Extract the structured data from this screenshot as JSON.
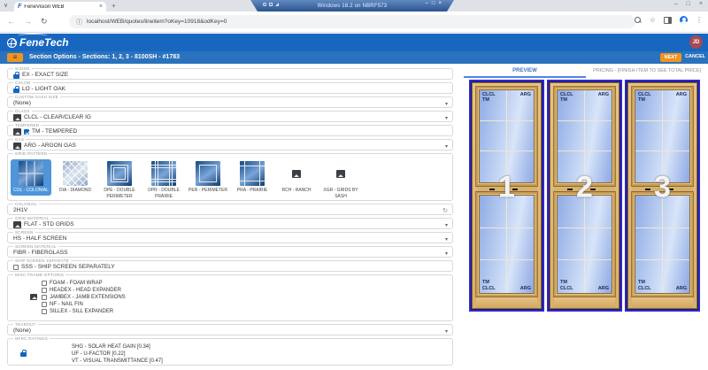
{
  "vm": {
    "title": "Windows 18.2 on NBRF573",
    "minimize": "–",
    "restore": "□",
    "close": "×"
  },
  "browser": {
    "tab_title": "FeneVision WEB",
    "favicon": "F",
    "tab_close": "×",
    "new_tab": "+",
    "tab_chevron": "∨",
    "back": "←",
    "forward": "→",
    "reload": "↻",
    "url_info": "ⓘ",
    "url": "localhost/WEB/quotes/lineitem?oKey=10918&odKey=0",
    "star": "☆",
    "kebab": "⋮",
    "win_minimize": "–",
    "win_maximize": "□",
    "win_close": "×"
  },
  "header": {
    "brand": "FeneTech",
    "avatar": "JD"
  },
  "sectionbar": {
    "hamburger": "≡",
    "title": "Section Options - Sections: 1, 2, 3 - 8100SH - #1783",
    "next": "NEXT",
    "cancel": "CANCEL"
  },
  "ui": {
    "caret": "▾",
    "refresh": "↻"
  },
  "form": {
    "sizing": {
      "label": "SIZING",
      "value": "EX - EXACT SIZE"
    },
    "color": {
      "label": "COLOR",
      "value": "LO - LIGHT OAK"
    },
    "custom_sash_size": {
      "label": "CUSTOM SASH SIZE",
      "value": "(None)"
    },
    "glass": {
      "label": "GLASS",
      "value": "CLCL - CLEAR/CLEAR IG"
    },
    "tempered": {
      "label": "TEMPERED",
      "value": "TM - TEMPERED"
    },
    "gas": {
      "label": "GAS",
      "value": "ARG - ARGON GAS"
    },
    "grid_pattern": {
      "label": "GRID PATTERN",
      "tiles": [
        {
          "caption": "COL - COLONIAL"
        },
        {
          "caption": "DIA - DIAMOND"
        },
        {
          "caption": "DPE - DOUBLE PERIMETER"
        },
        {
          "caption": "DPR - DOUBLE PRAIRIE"
        },
        {
          "caption": "PER - PERIMETER"
        },
        {
          "caption": "PRA - PRAIRIE"
        },
        {
          "caption": "RCH - RANCH"
        },
        {
          "caption": "XGR - GRIDS BY SASH"
        }
      ]
    },
    "colonial": {
      "label": "COLONIAL",
      "value": "2H1V"
    },
    "grid_material": {
      "label": "GRID MATERIAL",
      "value": "FLAT - STD GRIDS"
    },
    "screen": {
      "label": "SCREEN",
      "value": "HS - HALF SCREEN"
    },
    "screen_material": {
      "label": "SCREEN MATERIAL",
      "value": "FIBR - FIBERGLASS"
    },
    "ship_screen_separate": {
      "label": "SHIP SCREEN SEPARATE",
      "option": "SSS - SHIP SCREEN SEPARATELY"
    },
    "misc_frame_options": {
      "label": "MISC FRAME OPTIONS",
      "options": [
        "FOAM - FOAM WRAP",
        "HEADEX - HEAD EXPANDER",
        "JAMBEX - JAMB EXTENSIONS",
        "NF - NAIL FIN",
        "SILLEX - SILL EXPANDER"
      ]
    },
    "tearout": {
      "label": "TEAROUT",
      "value": "(None)"
    },
    "nfrc": {
      "label": "NFRC RATINGS",
      "lines": [
        "SHG - SOLAR HEAT GAIN [0.34]",
        "UF - U-FACTOR [0.22]",
        "VT - VISUAL TRANSMITTANCE [0.47]"
      ]
    }
  },
  "preview": {
    "tab_preview": "PREVIEW",
    "tab_pricing": "PRICING - [FINISH ITEM TO SEE TOTAL PRICE]",
    "windows": [
      {
        "number": "1",
        "top_l1": "CLCL",
        "top_l2": "TM",
        "top_r": "ARG",
        "bot_l1": "TM",
        "bot_l2": "CLCL",
        "bot_r": "ARG"
      },
      {
        "number": "2",
        "top_l1": "CLCL",
        "top_l2": "TM",
        "top_r": "ARG",
        "bot_l1": "TM",
        "bot_l2": "CLCL",
        "bot_r": "ARG"
      },
      {
        "number": "3",
        "top_l1": "CLCL",
        "top_l2": "TM",
        "top_r": "ARG",
        "bot_l1": "TM",
        "bot_l2": "CLCL",
        "bot_r": "ARG"
      }
    ]
  },
  "colors": {
    "header_blue": "#1766c0",
    "section_blue": "#2a72bd",
    "accent_orange": "#ef9322",
    "selected_tile_blue": "#4e95d9",
    "avatar_red": "#a84a52",
    "preview_border_blue": "#2f28cb",
    "oak_frame": "#e6c285"
  }
}
